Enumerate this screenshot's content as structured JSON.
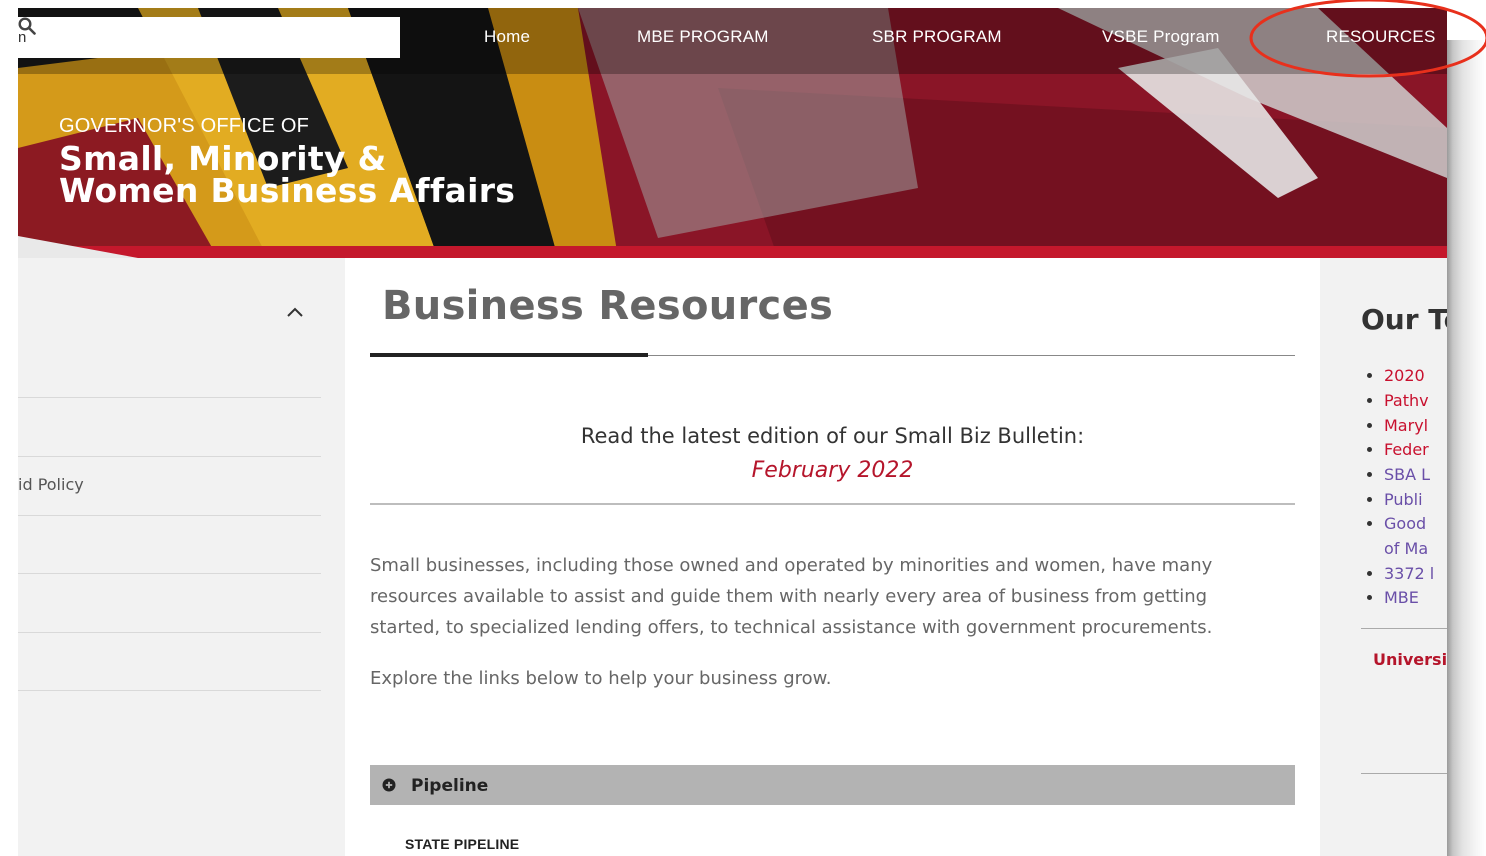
{
  "search": {
    "value": "n",
    "placeholder": ""
  },
  "nav": {
    "home": "Home",
    "mbe": "MBE PROGRAM",
    "sbr": "SBR PROGRAM",
    "vsbe": "VSBE Program",
    "resources": "RESOURCES"
  },
  "brand": {
    "pre": "GOVERNOR'S OFFICE OF",
    "line1": "Small, Minority &",
    "line2": "Women Business Affairs"
  },
  "sidebar": {
    "items": [
      "",
      "id Policy",
      "",
      "",
      ""
    ]
  },
  "main": {
    "title": "Business Resources",
    "bulletin_text": "Read the latest edition of our Small Biz Bulletin:",
    "bulletin_link": "February 2022",
    "paragraph": "Small businesses, including those owned and operated by minorities and women, have many resources available to assist and guide them with nearly every area of business from getting started, to specialized lending offers, to technical assistance with government procurements.",
    "paragraph2": "Explore the links below to help your business grow.",
    "accordion_label": "Pipeline",
    "sub_heading": "STATE PIPELINE"
  },
  "right": {
    "title": "Our To",
    "links": [
      "2020",
      "Pathv",
      "Maryl",
      "Feder",
      "SBA L",
      "Publi",
      "Good",
      "of Ma",
      "3372 l",
      "MBE"
    ],
    "university": "Universit"
  },
  "colors": {
    "accent_red": "#b5152b",
    "link_purple": "#6a4fa8",
    "annotation": "#e8301c"
  },
  "icons": [
    "search-icon",
    "chevron-up-icon",
    "plus-circle-icon"
  ]
}
